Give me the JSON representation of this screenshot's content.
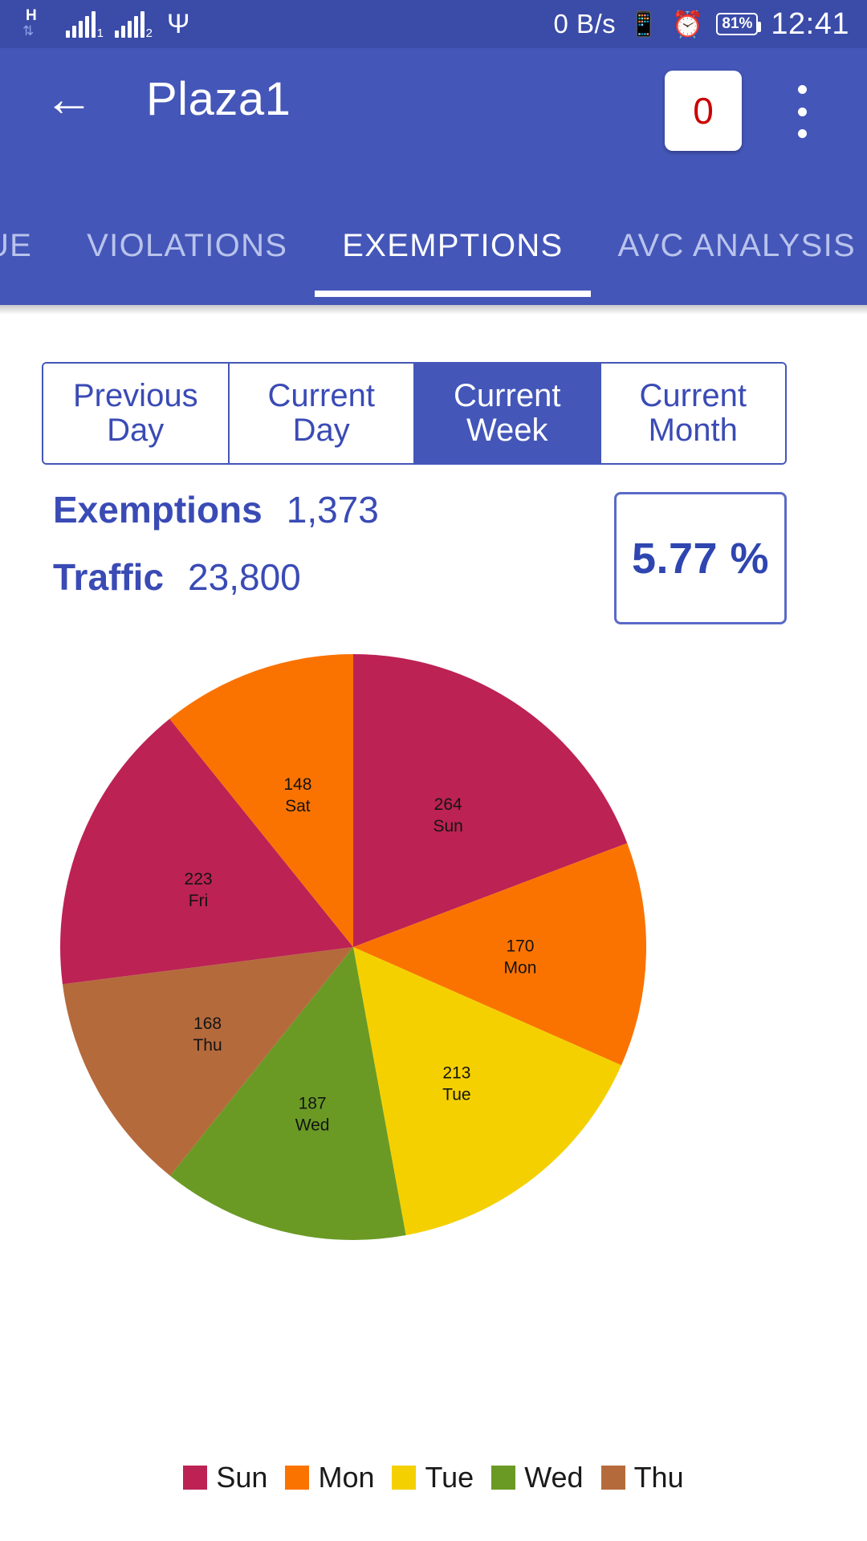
{
  "status_bar": {
    "network_type": "H",
    "data_arrows": "⇅",
    "sim1_label": "1",
    "sim2_label": "2",
    "usb_icon": "usb-icon",
    "net_speed": "0 B/s",
    "vibrate_icon": "vibrate-icon",
    "alarm_icon": "alarm-icon",
    "battery": "81%",
    "time": "12:41"
  },
  "appbar": {
    "back_icon": "back-arrow-icon",
    "title": "Plaza1",
    "badge_count": "0",
    "overflow_icon": "more-vertical-icon"
  },
  "tabs": {
    "items": [
      {
        "label": "UE",
        "active": false
      },
      {
        "label": "VIOLATIONS",
        "active": false
      },
      {
        "label": "EXEMPTIONS",
        "active": true
      },
      {
        "label": "AVC ANALYSIS",
        "active": false
      }
    ]
  },
  "filters": {
    "options": [
      {
        "label": "Previous\nDay",
        "line1": "Previous",
        "line2": "Day",
        "active": false
      },
      {
        "label": "Current\nDay",
        "line1": "Current",
        "line2": "Day",
        "active": false
      },
      {
        "label": "Current\nWeek",
        "line1": "Current",
        "line2": "Week",
        "active": true
      },
      {
        "label": "Current\nMonth",
        "line1": "Current",
        "line2": "Month",
        "active": false
      }
    ]
  },
  "stats": {
    "exemptions_label": "Exemptions",
    "exemptions_value": "1,373",
    "traffic_label": "Traffic",
    "traffic_value": "23,800",
    "percentage": "5.77 %"
  },
  "colors": {
    "primary": "#4456B8",
    "status_bar": "#3A4BA8",
    "accent_text": "#3A4BB5",
    "badge_text": "#CC0000"
  },
  "chart_data": {
    "type": "pie",
    "title": "",
    "categories": [
      "Sun",
      "Mon",
      "Tue",
      "Wed",
      "Thu",
      "Fri",
      "Sat"
    ],
    "values": [
      264,
      170,
      213,
      187,
      168,
      223,
      148
    ],
    "total": 1373,
    "colors": [
      "#BC2254",
      "#FA7300",
      "#F5D000",
      "#6A9A24",
      "#B56A3C",
      "#BC2254",
      "#FA7300"
    ],
    "labels": [
      {
        "value": "264",
        "name": "Sun"
      },
      {
        "value": "170",
        "name": "Mon"
      },
      {
        "value": "213",
        "name": "Tue"
      },
      {
        "value": "187",
        "name": "Wed"
      },
      {
        "value": "168",
        "name": "Thu"
      },
      {
        "value": "223",
        "name": "Fri"
      },
      {
        "value": "148",
        "name": "Sat"
      }
    ],
    "legend_position": "bottom",
    "legend": [
      {
        "label": "Sun",
        "color": "#BC2254"
      },
      {
        "label": "Mon",
        "color": "#FA7300"
      },
      {
        "label": "Tue",
        "color": "#F5D000"
      },
      {
        "label": "Wed",
        "color": "#6A9A24"
      },
      {
        "label": "Thu",
        "color": "#B56A3C"
      }
    ]
  }
}
